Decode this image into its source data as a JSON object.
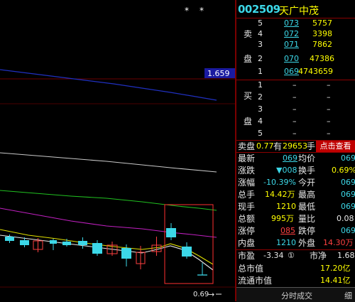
{
  "chart": {
    "ma_price_label": "1.659",
    "bottom_readout": "0.69",
    "markers": [
      "*",
      "*"
    ]
  },
  "quote": {
    "code": "002509",
    "name": "天广中茂",
    "sell_side_label": [
      "卖",
      "盘"
    ],
    "buy_side_label": [
      "买",
      "盘"
    ],
    "asks": [
      {
        "level": "5",
        "price": "073",
        "volume": "5757"
      },
      {
        "level": "4",
        "price": "072",
        "volume": "3398"
      },
      {
        "level": "3",
        "price": "071",
        "volume": "7862"
      },
      {
        "level": "2",
        "price": "070",
        "volume": "47386"
      },
      {
        "level": "1",
        "price": "069",
        "volume": "4743659"
      }
    ],
    "bids": [
      {
        "level": "1",
        "price": "–",
        "volume": "–"
      },
      {
        "level": "2",
        "price": "–",
        "volume": "–"
      },
      {
        "level": "3",
        "price": "–",
        "volume": "–"
      },
      {
        "level": "4",
        "price": "–",
        "volume": "–"
      },
      {
        "level": "5",
        "price": "–",
        "volume": "–"
      }
    ],
    "order_line": {
      "label": "卖盘",
      "value1": "0.77",
      "mid": "有",
      "value2": "29653",
      "unit": "手",
      "button": "点击查看"
    },
    "stats": [
      {
        "l1": "最新",
        "v1": "069",
        "l2": "均价",
        "v2": "069"
      },
      {
        "l1": "涨跌",
        "v1": "▼008",
        "l2": "换手",
        "v2": "0.69%"
      },
      {
        "l1": "涨幅",
        "v1": "-10.39%",
        "l2": "今开",
        "v2": "069"
      },
      {
        "l1": "总手",
        "v1": "14.42万",
        "l2": "最高",
        "v2": "069"
      },
      {
        "l1": "现手",
        "v1": "1210",
        "l2": "最低",
        "v2": "069"
      },
      {
        "l1": "总额",
        "v1": "995万",
        "l2": "量比",
        "v2": "0.08"
      },
      {
        "l1": "涨停",
        "v1": "085",
        "l2": "跌停",
        "v2": "069"
      },
      {
        "l1": "内盘",
        "v1": "1210",
        "l2": "外盘",
        "v2": "14.30万"
      }
    ],
    "pe_row": {
      "l1": "市盈",
      "v1": "-3.34",
      "badge": "①",
      "l2": "市净",
      "v2": "1.68"
    },
    "total_mv": {
      "label": "总市值",
      "value": "17.20亿"
    },
    "float_mv": {
      "label": "流通市值",
      "value": "14.41亿"
    },
    "tabs": [
      "分时成交",
      "细"
    ]
  },
  "colors": {
    "up": "#ff4040",
    "down": "#3cd8e8",
    "ma_blue": "#2030c0",
    "ma_white": "#c8c8c8",
    "ma_green": "#20c020",
    "ma_magenta": "#c020c0",
    "ma_yellow": "#e0e000"
  }
}
